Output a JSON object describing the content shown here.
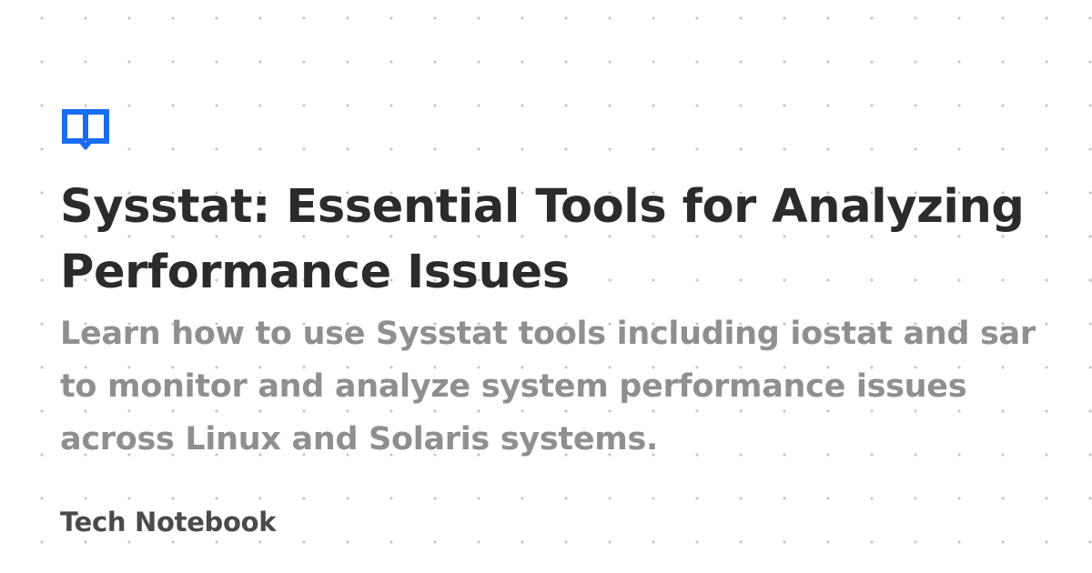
{
  "brand": {
    "icon": "open-book-icon",
    "color": "#1a6cf0",
    "site_name": "Tech Notebook"
  },
  "article": {
    "title": "Sysstat: Essential Tools for Analyzing Performance Issues",
    "description": "Learn how to use Sysstat tools including iostat and sar to monitor and analyze system performance issues across Linux and Solaris systems."
  },
  "colors": {
    "background": "#ffffff",
    "dot_pattern": "#c4c4c4",
    "title": "#2b2b2b",
    "description": "#8f8f8f",
    "site_name": "#4a4a4a"
  }
}
